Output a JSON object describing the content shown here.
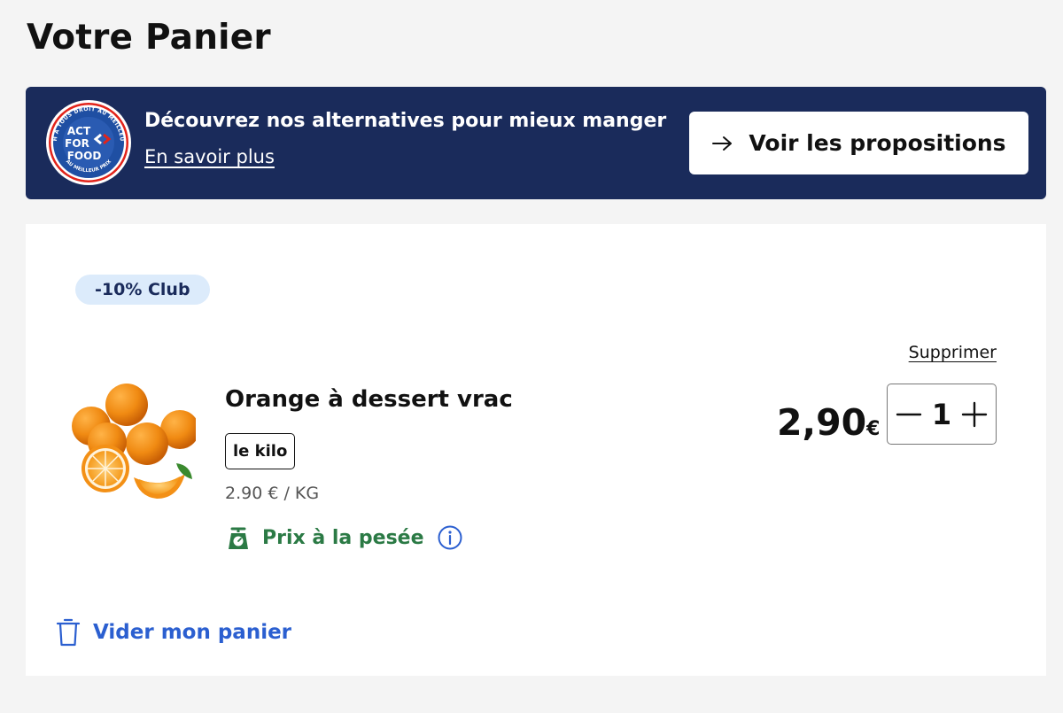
{
  "page": {
    "title": "Votre Panier"
  },
  "banner": {
    "logo_icon": "act-for-food-logo",
    "logo_lines": [
      "ACT",
      "FOR",
      "FOOD"
    ],
    "logo_ring_top": "OH À TOUS DROIT AU MEILLEUR",
    "logo_ring_bottom": "AU MEILLEUR PRIX",
    "title": "Découvrez nos alternatives pour mieux manger",
    "link": "En savoir plus",
    "cta_label": "Voir les propositions",
    "cta_icon": "arrow-right-icon",
    "background": "#1a2b5b"
  },
  "cart": {
    "items": [
      {
        "promo": "-10% Club",
        "name": "Orange à dessert vrac",
        "image_icon": "oranges-image",
        "unit": "le kilo",
        "unit_price": "2.90 € / KG",
        "weigh_label": "Prix à la pesée",
        "weigh_icon": "scale-icon",
        "info_icon": "info-icon",
        "delete_label": "Supprimer",
        "price_main": "2,90",
        "price_currency": "€",
        "quantity": "1",
        "decrement_icon": "minus-icon",
        "increment_icon": "plus-icon"
      }
    ],
    "empty_label": "Vider mon panier",
    "empty_icon": "trash-icon"
  },
  "colors": {
    "promo_bg": "#dcebfb",
    "weigh_green": "#2b7a45",
    "link_blue": "#2b5fd0"
  }
}
